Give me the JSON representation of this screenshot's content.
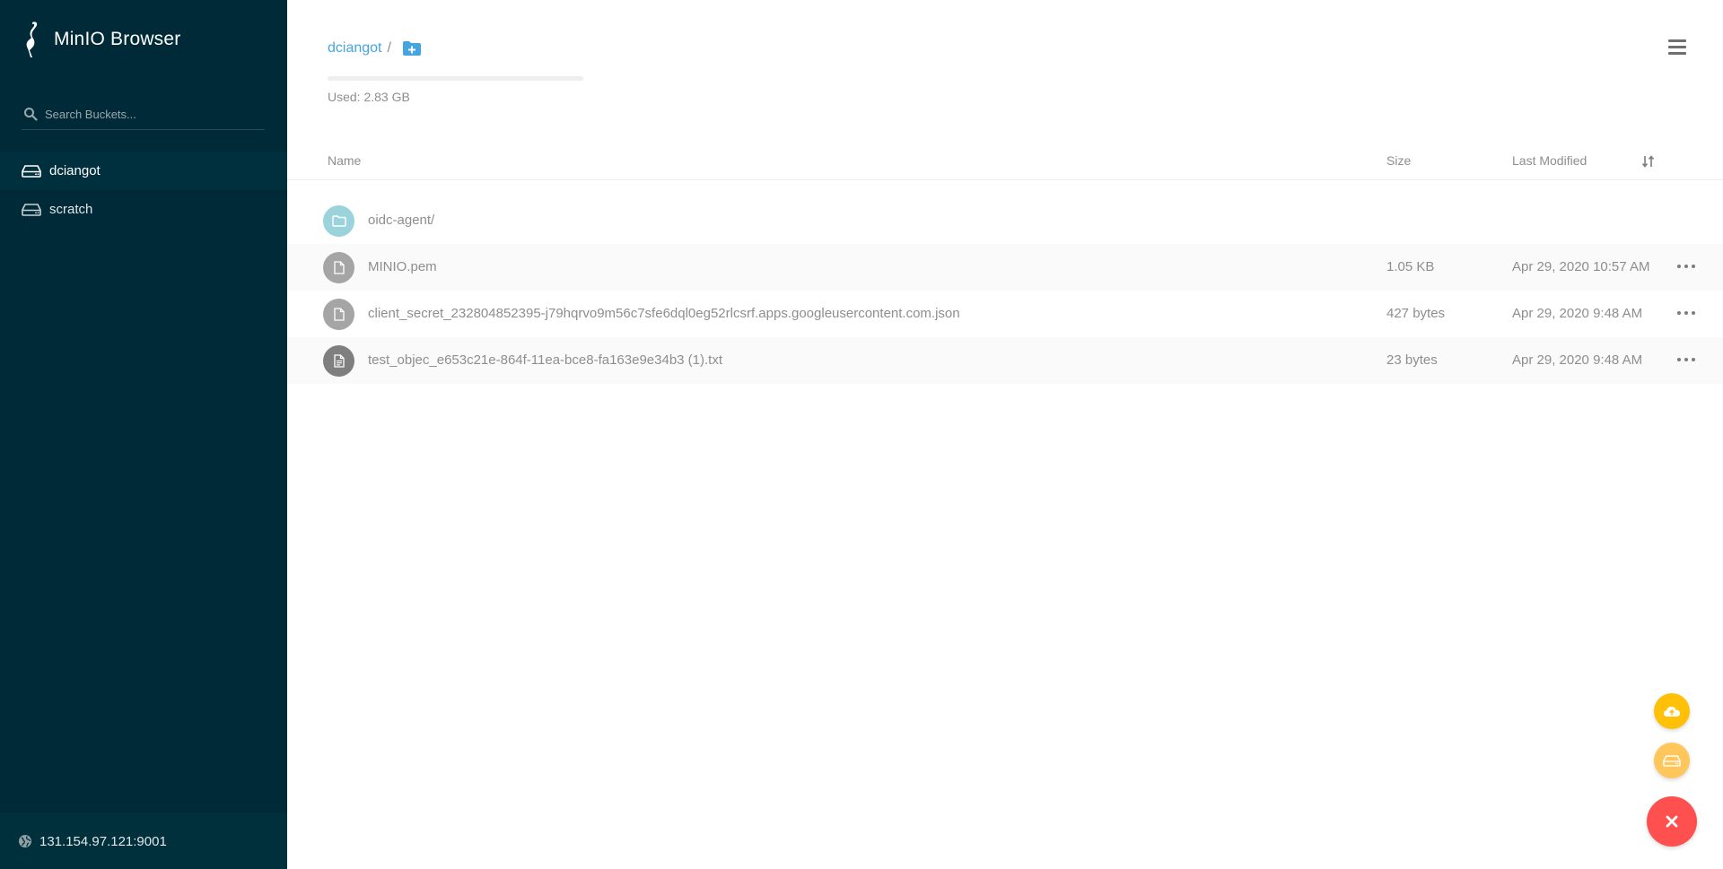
{
  "app": {
    "title": "MinIO Browser"
  },
  "sidebar": {
    "search_placeholder": "Search Buckets...",
    "buckets": [
      {
        "label": "dciangot",
        "active": true
      },
      {
        "label": "scratch",
        "active": false
      }
    ],
    "host": "131.154.97.121:9001"
  },
  "main": {
    "breadcrumb": {
      "bucket": "dciangot",
      "separator": "/"
    },
    "usage": {
      "text": "Used: 2.83 GB",
      "fraction": 0.0
    },
    "table": {
      "headers": {
        "name": "Name",
        "size": "Size",
        "last_modified": "Last Modified"
      },
      "rows": [
        {
          "name": "oidc-agent/",
          "size": "",
          "modified": "",
          "kind": "folder"
        },
        {
          "name": "MINIO.pem",
          "size": "1.05 KB",
          "modified": "Apr 29, 2020 10:57 AM",
          "kind": "file"
        },
        {
          "name": "client_secret_232804852395-j79hqrvo9m56c7sfe6dql0eg52rlcsrf.apps.googleusercontent.com.json",
          "size": "427 bytes",
          "modified": "Apr 29, 2020 9:48 AM",
          "kind": "file"
        },
        {
          "name": "test_objec_e653c21e-864f-11ea-bce8-fa163e9e34b3 (1).txt",
          "size": "23 bytes",
          "modified": "Apr 29, 2020 9:48 AM",
          "kind": "text"
        }
      ]
    }
  },
  "colors": {
    "sidebar_bg": "#002a37",
    "accent_link": "#46a5e0",
    "folder_icon": "#9bd3dd",
    "file_icon": "#a5a5a5",
    "text_icon": "#7f7f7f",
    "fab_upload": "#ffc107",
    "fab_bucket": "#ffc65b",
    "fab_close": "#ff5050"
  },
  "icons": {
    "logo": "minio-bird-icon",
    "search": "search-icon",
    "bucket": "hard-drive-icon",
    "host": "globe-icon",
    "add_folder": "folder-plus-icon",
    "menu": "hamburger-menu-icon",
    "sort": "sort-icon",
    "folder": "folder-icon",
    "file": "file-icon",
    "text_file": "file-text-icon",
    "more": "ellipsis-icon",
    "upload": "cloud-upload-icon",
    "create_bucket": "hard-drive-icon",
    "close": "close-icon"
  }
}
